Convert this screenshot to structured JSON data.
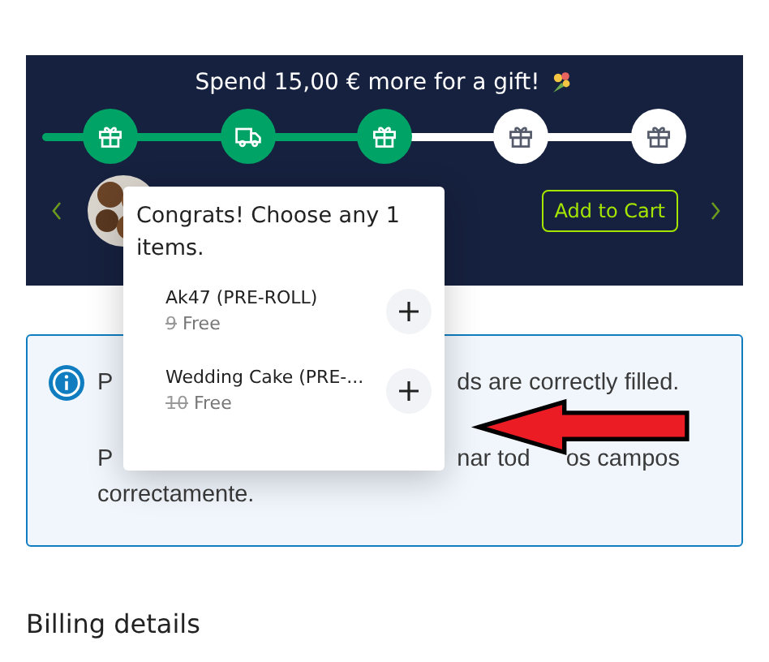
{
  "gift_banner": {
    "title": "Spend 15,00 € more for a gift!",
    "steps": [
      {
        "kind": "gift",
        "reached": true
      },
      {
        "kind": "truck",
        "reached": true
      },
      {
        "kind": "gift",
        "reached": true
      },
      {
        "kind": "gift",
        "reached": false
      },
      {
        "kind": "gift",
        "reached": false
      }
    ],
    "product": {
      "button": "Add to Cart"
    }
  },
  "gift_popup": {
    "heading": "Congrats! Choose any 1 items.",
    "items": [
      {
        "name": "Ak47 (PRE-ROLL)",
        "old_price": "9",
        "price": "Free"
      },
      {
        "name": "Wedding Cake (PRE-...",
        "old_price": "10",
        "price": "Free"
      }
    ]
  },
  "notice": {
    "line_1": [
      "P",
      "ds are correctly filled."
    ],
    "line_2": [
      "P",
      "nar tod",
      "os campos"
    ],
    "line_3": "correctamente."
  },
  "section_title": "Billing details"
}
